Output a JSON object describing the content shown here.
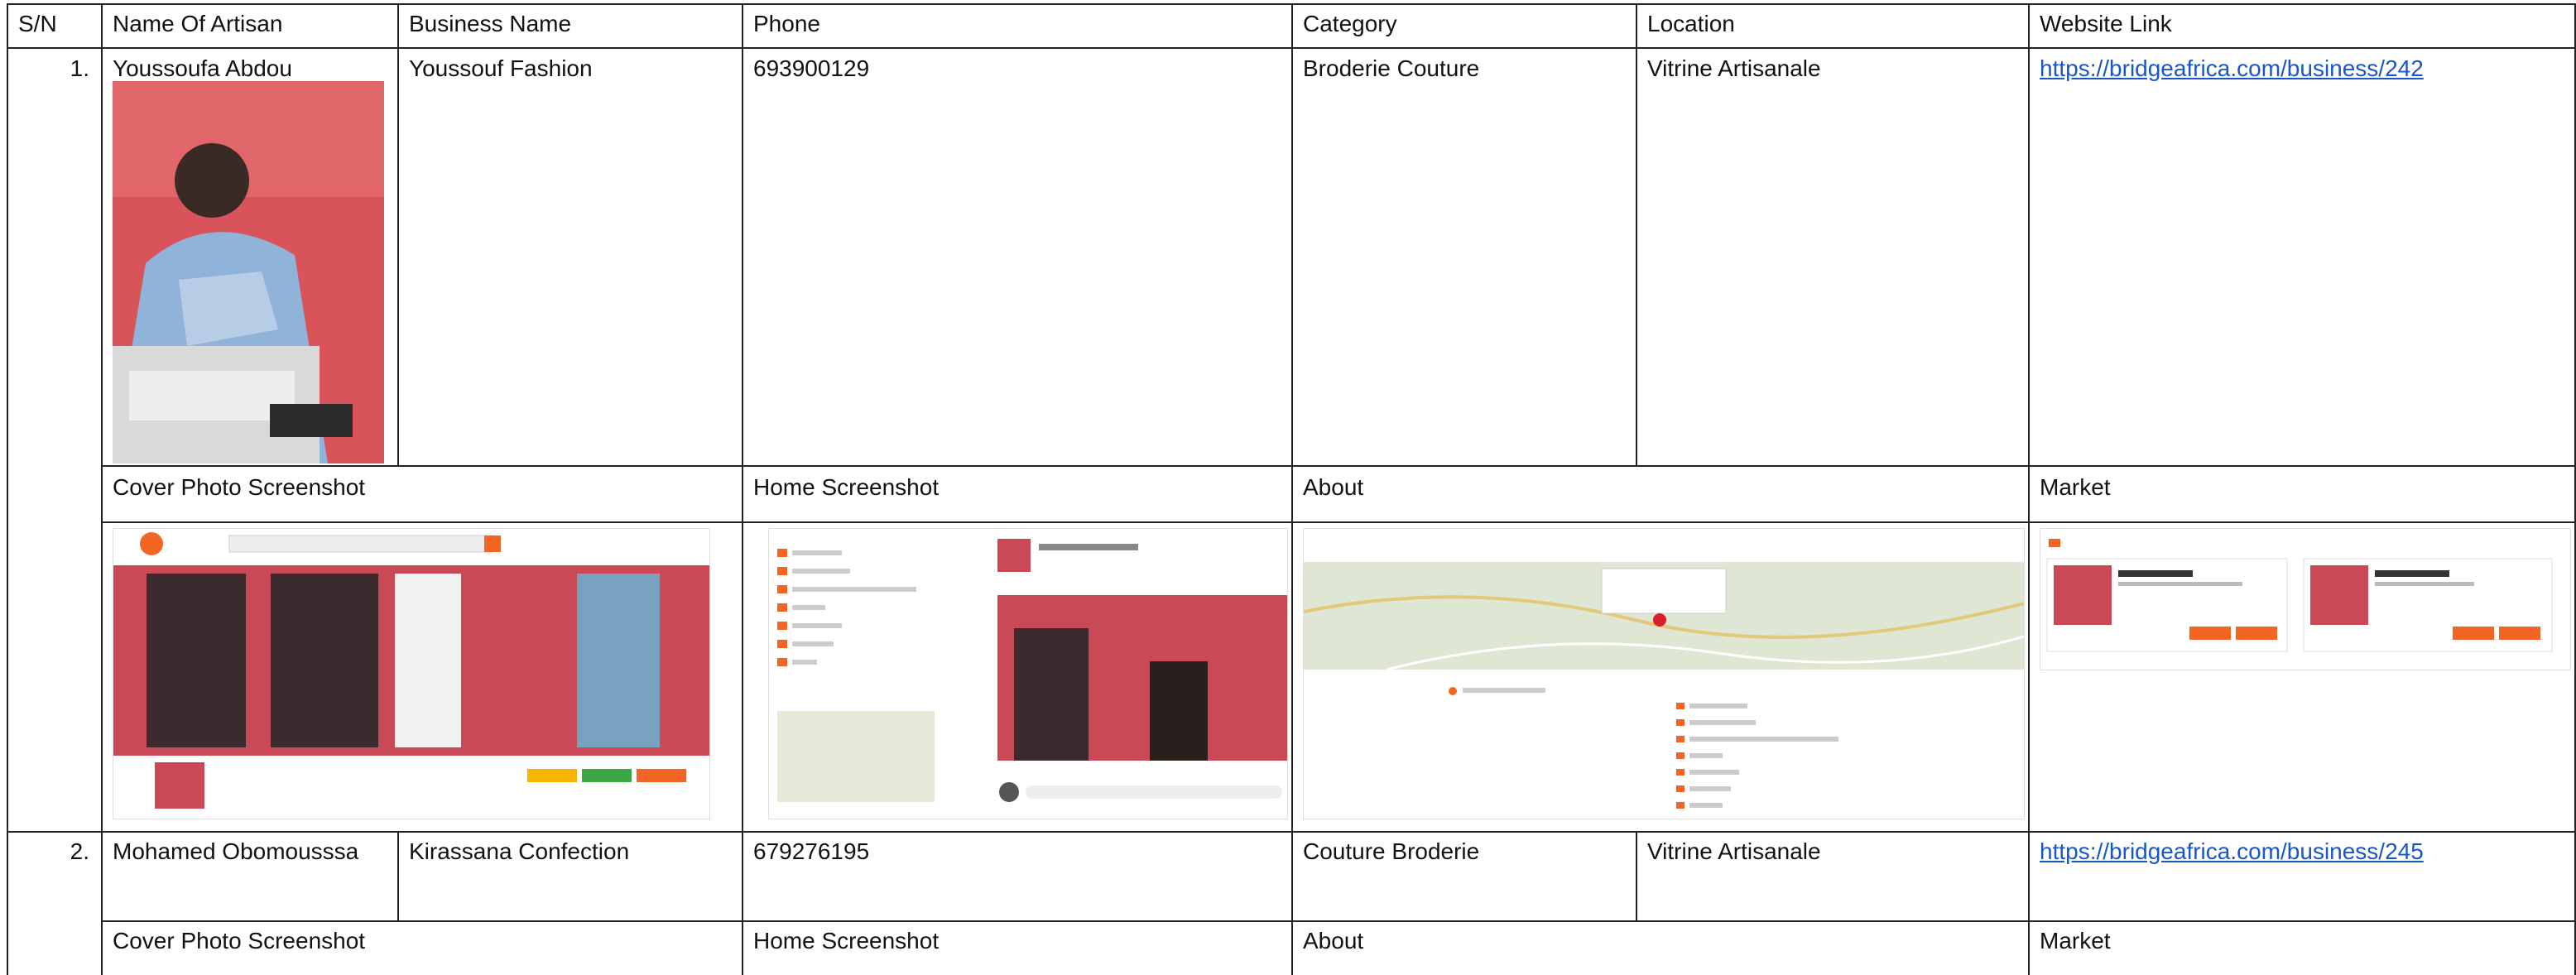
{
  "headers": {
    "sn": "S/N",
    "name": "Name Of Artisan",
    "business": "Business Name",
    "phone": "Phone",
    "category": "Category",
    "location": "Location",
    "website": "Website Link"
  },
  "sub_headers": {
    "cover": "Cover Photo Screenshot",
    "home": "Home Screenshot",
    "about": "About",
    "market": "Market"
  },
  "rows": [
    {
      "sn": "1.",
      "name": "Youssoufa Abdou",
      "business": "Youssouf Fashion",
      "phone": "693900129",
      "category": "Broderie Couture",
      "location": "Vitrine Artisanale",
      "website": "https://bridgeafrica.com/business/242"
    },
    {
      "sn": "2.",
      "name": "Mohamed Obomousssa",
      "business": "Kirassana Confection",
      "phone": "679276195",
      "category": "Couture Broderie",
      "location": "Vitrine Artisanale",
      "website": "https://bridgeafrica.com/business/245"
    }
  ],
  "colors": {
    "accent_orange": "#f26522",
    "link_blue": "#1a56c4",
    "photo_red": "#d8545a"
  }
}
